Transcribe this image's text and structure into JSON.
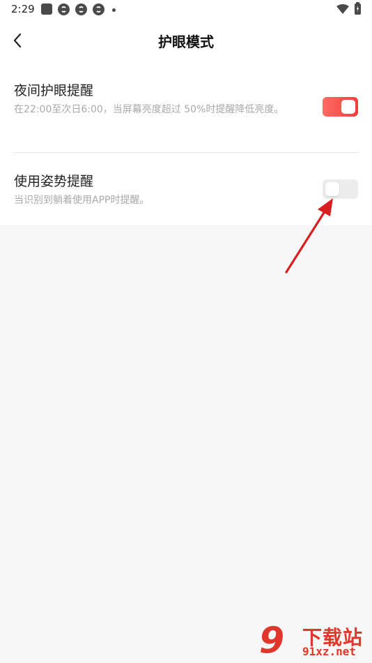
{
  "status_bar": {
    "time": "2:29",
    "icons": [
      "square-notification-icon",
      "app-icon",
      "app-icon",
      "app-icon",
      "dot-icon",
      "wifi-icon",
      "battery-charging-icon"
    ]
  },
  "header": {
    "back_icon": "chevron-left-icon",
    "title": "护眼模式"
  },
  "settings": [
    {
      "title": "夜间护眼提醒",
      "description": "在22:00至次日6:00，当屏幕亮度超过 50%时提醒降低亮度。",
      "enabled": true
    },
    {
      "title": "使用姿势提醒",
      "description": "当识别到躺着使用APP时提醒。",
      "enabled": false
    }
  ],
  "colors": {
    "accent": "#f2453f",
    "toggle_off": "#ececec",
    "page_background": "#f7f7f7",
    "arrow": "#d81e1e"
  },
  "watermark": {
    "logo_text": "9",
    "title": "下载站",
    "url": "91xz.net"
  }
}
